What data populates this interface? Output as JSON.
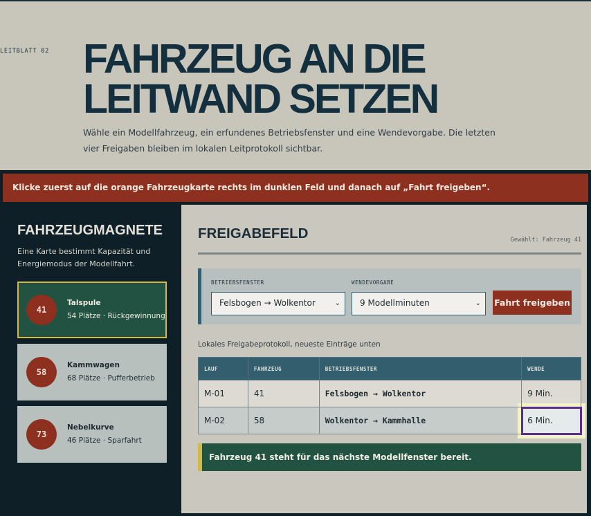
{
  "hero": {
    "kicker": "LEITBLATT 02",
    "title_line1": "FAHRZEUG AN DIE",
    "title_line2": "LEITWAND SETZEN",
    "subtitle": "Wähle ein Modellfahrzeug, ein erfundenes Betriebsfenster und eine Wendevorgabe. Die letzten vier Freigaben bleiben im lokalen Leitprotokoll sichtbar."
  },
  "alert": {
    "text": "Klicke zuerst auf die orange Fahrzeugkarte rechts im dunklen Feld und danach auf „Fahrt freigeben“."
  },
  "sidebar": {
    "title": "FAHRZEUGMAGNETE",
    "description": "Eine Karte bestimmt Kapazität und Energiemodus der Modellfahrt.",
    "cards": [
      {
        "number": "41",
        "name": "Talspule",
        "meta": "54 Plätze · Rückgewinnung",
        "selected": true
      },
      {
        "number": "58",
        "name": "Kammwagen",
        "meta": "68 Plätze · Pufferbetrieb",
        "selected": false
      },
      {
        "number": "73",
        "name": "Nebelkurve",
        "meta": "46 Plätze · Sparfahrt",
        "selected": false
      }
    ]
  },
  "panel": {
    "title": "FREIGABEFELD",
    "selected_text": "Gewählt: Fahrzeug 41",
    "window_label": "BETRIEBSFENSTER",
    "window_value": "Felsbogen → Wolkentor",
    "turn_label": "WENDEVORGABE",
    "turn_value": "9 Modellminuten",
    "release_button": "Fahrt freigeben",
    "log_caption": "Lokales Freigabeprotokoll, neueste Einträge unten",
    "log_headers": [
      "LAUF",
      "FAHRZEUG",
      "BETRIEBSFENSTER",
      "WENDE"
    ],
    "log_rows": [
      {
        "lauf": "M-01",
        "fahrzeug": "41",
        "fenster": "Felsbogen → Wolkentor",
        "wende": "9 Min."
      },
      {
        "lauf": "M-02",
        "fahrzeug": "58",
        "fenster": "Wolkentor → Kammhalle",
        "wende": "6 Min."
      }
    ],
    "status": "Fahrzeug 41 steht für das nächste Modellfenster bereit."
  },
  "colors": {
    "background": "#c8c5bb",
    "dark": "#0f1f28",
    "accent_red": "#8e301f",
    "accent_green": "#215242",
    "accent_gold": "#d4b84a",
    "teal": "#325e6d"
  }
}
